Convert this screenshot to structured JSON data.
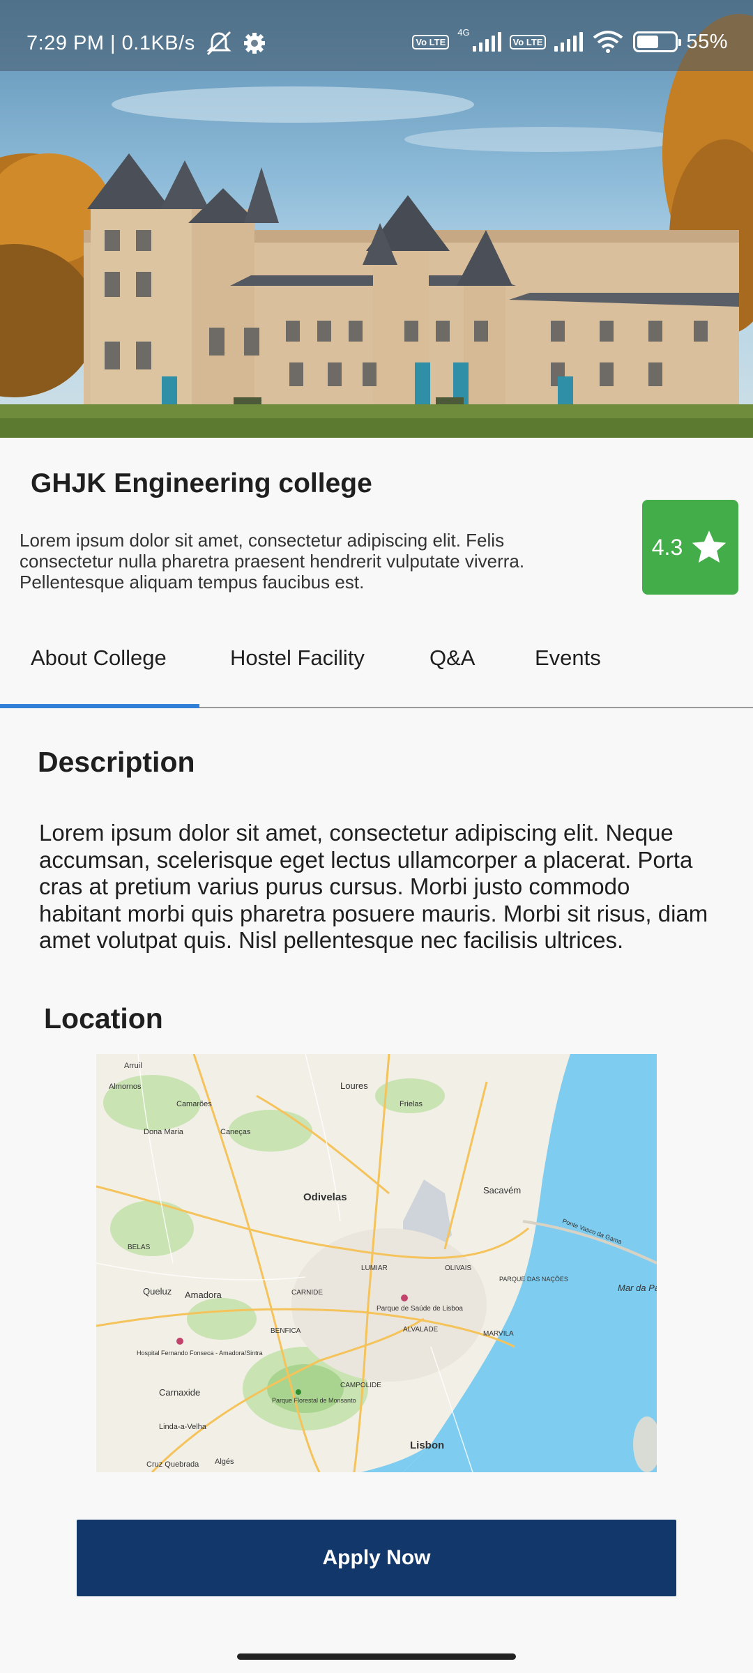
{
  "status_bar": {
    "time_speed": "7:29 PM | 0.1KB/s",
    "volte_label": "Vo LTE",
    "network_type": "4G",
    "battery": "55%",
    "battery_level": 0.55,
    "icons": [
      "mute-icon",
      "settings-gear-icon",
      "signal-icon",
      "wifi-icon",
      "battery-icon"
    ]
  },
  "college": {
    "name": "GHJK Engineering college",
    "intro": "Lorem ipsum dolor sit amet, consectetur adipiscing elit. Felis consectetur nulla pharetra praesent hendrerit vulputate viverra. Pellentesque aliquam tempus faucibus est.",
    "rating": "4.3",
    "rating_color": "#43ad49"
  },
  "tabs": [
    {
      "label": "About College",
      "active": true
    },
    {
      "label": "Hostel Facility",
      "active": false
    },
    {
      "label": "Q&A",
      "active": false
    },
    {
      "label": "Events",
      "active": false
    }
  ],
  "tab_accent": "#2f80d6",
  "description": {
    "heading": "Description",
    "text": "Lorem ipsum dolor sit amet, consectetur adipiscing elit. Neque accumsan, scelerisque eget lectus ullamcorper a placerat. Porta cras at pretium varius purus cursus. Morbi justo commodo habitant morbi quis pharetra posuere mauris. Morbi sit risus, diam amet volutpat quis. Nisl pellentesque nec facilisis ultrices."
  },
  "location": {
    "heading": "Location",
    "map_labels": {
      "odivelas": "Odivelas",
      "loures": "Loures",
      "sacavem": "Sacavém",
      "lisbon": "Lisbon",
      "queluz": "Queluz",
      "amadora": "Amadora",
      "carnaxide": "Carnaxide",
      "almornos": "Almornos",
      "caneças": "Caneças",
      "dona_maria": "Dona Maria",
      "camaroes": "Camarões",
      "frielas": "Frielas",
      "linda_a_velha": "Linda-a-Velha",
      "parque_saude": "Parque de Saúde de Lisboa",
      "hospital": "Hospital Fernando Fonseca - Amadora/Sintra",
      "monsanto": "Parque Florestal de Monsanto",
      "mar_da_palha": "Mar da Pa",
      "arruil": "Arruil",
      "alvalade": "ALVALADE",
      "benfica": "BENFICA",
      "carnide": "CARNIDE",
      "olivais": "OLIVAIS",
      "parque_nacoes": "PARQUE DAS NAÇÕES",
      "marvila": "MARVILA",
      "campolide": "CAMPOLIDE",
      "lumiar": "LUMIAR",
      "belas": "BELAS",
      "alges": "Algés",
      "cruz_quebrada": "Cruz Quebrada",
      "ponte": "Ponte Vasco da Gama"
    },
    "colors": {
      "water": "#7ecdf0",
      "land": "#f2efe6",
      "green": "#b8dca3",
      "road": "#f4c35b"
    }
  },
  "apply_button": {
    "label": "Apply Now",
    "color": "#12386b"
  }
}
